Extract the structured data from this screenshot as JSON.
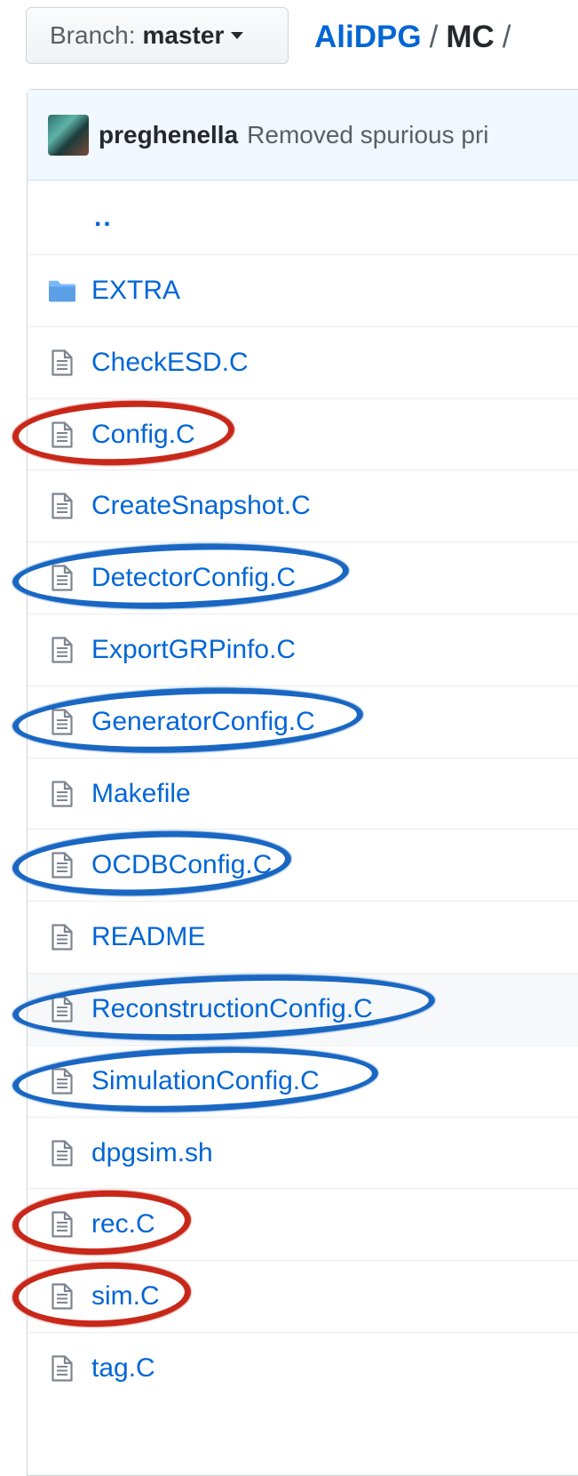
{
  "branch": {
    "prefix": "Branch:",
    "name": "master"
  },
  "breadcrumb": {
    "repo": "AliDPG",
    "sep1": "/",
    "folder": "MC",
    "sep2": "/"
  },
  "commit": {
    "author": "preghenella",
    "message": "Removed spurious pri"
  },
  "files": {
    "parent": "..",
    "items": [
      {
        "name": "EXTRA",
        "type": "folder"
      },
      {
        "name": "CheckESD.C",
        "type": "file"
      },
      {
        "name": "Config.C",
        "type": "file",
        "circle": "red"
      },
      {
        "name": "CreateSnapshot.C",
        "type": "file"
      },
      {
        "name": "DetectorConfig.C",
        "type": "file",
        "circle": "blue"
      },
      {
        "name": "ExportGRPinfo.C",
        "type": "file"
      },
      {
        "name": "GeneratorConfig.C",
        "type": "file",
        "circle": "blue"
      },
      {
        "name": "Makefile",
        "type": "file"
      },
      {
        "name": "OCDBConfig.C",
        "type": "file",
        "circle": "blue"
      },
      {
        "name": "README",
        "type": "file"
      },
      {
        "name": "ReconstructionConfig.C",
        "type": "file",
        "circle": "blue",
        "highlighted": true
      },
      {
        "name": "SimulationConfig.C",
        "type": "file",
        "circle": "blue"
      },
      {
        "name": "dpgsim.sh",
        "type": "file"
      },
      {
        "name": "rec.C",
        "type": "file",
        "circle": "red"
      },
      {
        "name": "sim.C",
        "type": "file",
        "circle": "red"
      },
      {
        "name": "tag.C",
        "type": "file"
      }
    ]
  },
  "colors": {
    "link": "#0366d6",
    "red_mark": "#c7281a",
    "blue_mark": "#1a67c2"
  },
  "icons": {
    "folder": "folder-icon",
    "file": "file-icon"
  }
}
